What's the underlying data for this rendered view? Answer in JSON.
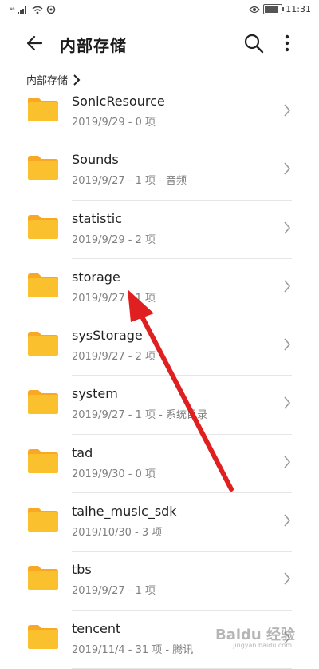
{
  "statusbar": {
    "signal_text": "⁴⁶",
    "time": "11:31"
  },
  "header": {
    "title": "内部存储"
  },
  "breadcrumb": {
    "label": "内部存储"
  },
  "folders": [
    {
      "name": "SonicResource",
      "meta": "2019/9/29 - 0 项"
    },
    {
      "name": "Sounds",
      "meta": "2019/9/27 - 1 项 - 音频"
    },
    {
      "name": "statistic",
      "meta": "2019/9/29 - 2 项"
    },
    {
      "name": "storage",
      "meta": "2019/9/27 - 1 项"
    },
    {
      "name": "sysStorage",
      "meta": "2019/9/27 - 2 项"
    },
    {
      "name": "system",
      "meta": "2019/9/27 - 1 项 - 系统目录"
    },
    {
      "name": "tad",
      "meta": "2019/9/30 - 0 项"
    },
    {
      "name": "taihe_music_sdk",
      "meta": "2019/10/30 - 3 项"
    },
    {
      "name": "tbs",
      "meta": "2019/9/27 - 1 项"
    },
    {
      "name": "tencent",
      "meta": "2019/11/4 - 31 项 - 腾讯"
    }
  ],
  "watermark": {
    "text": "Baidu 经验",
    "sub": "jingyan.baidu.com"
  },
  "colors": {
    "folder": "#FBC02D",
    "folder_tab": "#F9A825",
    "annotation_arrow": "#E02020"
  }
}
